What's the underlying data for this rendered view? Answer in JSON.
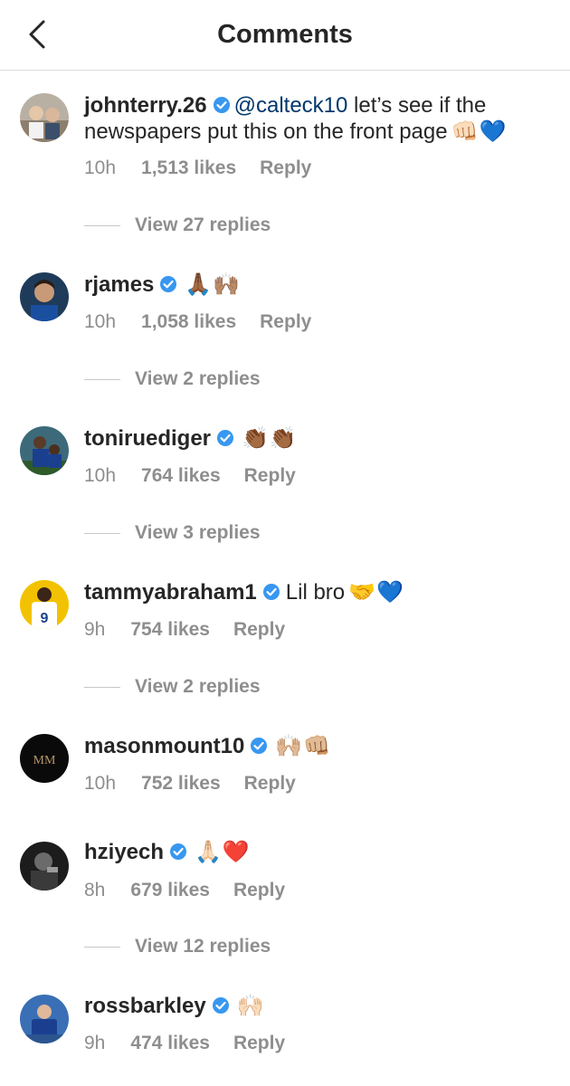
{
  "header": {
    "title": "Comments"
  },
  "comments": [
    {
      "username": "johnterry.26",
      "mention": "@calteck10",
      "text": " let’s see if the newspapers put this on the front page",
      "emoji": "👊🏻💙",
      "time": "10h",
      "likes": "1,513 likes",
      "reply": "Reply",
      "view_replies": "View 27 replies"
    },
    {
      "username": "rjames",
      "mention": "",
      "text": "",
      "emoji": "🙏🏾🙌🏽",
      "time": "10h",
      "likes": "1,058 likes",
      "reply": "Reply",
      "view_replies": "View 2 replies"
    },
    {
      "username": "toniruediger",
      "mention": "",
      "text": "",
      "emoji": "👏🏾👏🏾",
      "time": "10h",
      "likes": "764 likes",
      "reply": "Reply",
      "view_replies": "View 3 replies"
    },
    {
      "username": "tammyabraham1",
      "mention": "",
      "text": "Lil bro",
      "emoji": "🤝💙",
      "time": "9h",
      "likes": "754 likes",
      "reply": "Reply",
      "view_replies": "View 2 replies"
    },
    {
      "username": "masonmount10",
      "mention": "",
      "text": "",
      "emoji": "🙌🏼👊🏼",
      "time": "10h",
      "likes": "752 likes",
      "reply": "Reply",
      "view_replies": ""
    },
    {
      "username": "hziyech",
      "mention": "",
      "text": "",
      "emoji": "🙏🏻❤️",
      "time": "8h",
      "likes": "679 likes",
      "reply": "Reply",
      "view_replies": "View 12 replies"
    },
    {
      "username": "rossbarkley",
      "mention": "",
      "text": "",
      "emoji": "🙌🏻",
      "time": "9h",
      "likes": "474 likes",
      "reply": "Reply",
      "view_replies": ""
    }
  ],
  "avatars": {
    "masonmount10": "MM"
  },
  "colors": {
    "verified": "#3897f0",
    "mention": "#00376b",
    "meta": "#8e8e8e"
  }
}
